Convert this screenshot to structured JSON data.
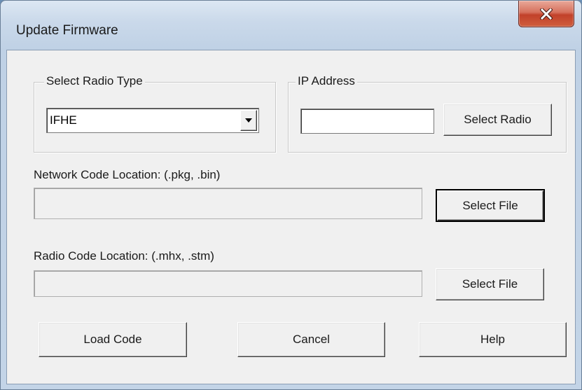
{
  "window": {
    "title": "Update Firmware",
    "close_glyph": "close-icon"
  },
  "radio_group": {
    "legend": "Select Radio Type",
    "selected": "IFHE"
  },
  "ip_group": {
    "legend": "IP Address",
    "ip_value": "",
    "select_radio_label": "Select Radio"
  },
  "network_code": {
    "label": "Network Code Location: (.pkg, .bin)",
    "value": "",
    "select_file_label": "Select File"
  },
  "radio_code": {
    "label": "Radio Code Location: (.mhx, .stm)",
    "value": "",
    "select_file_label": "Select File"
  },
  "actions": {
    "load_label": "Load Code",
    "cancel_label": "Cancel",
    "help_label": "Help"
  }
}
